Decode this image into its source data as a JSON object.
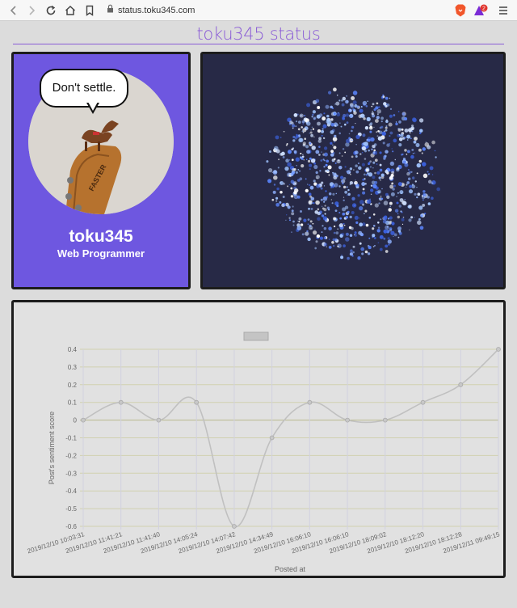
{
  "browser": {
    "url": "status.toku345.com",
    "back_icon": "back-arrow-icon",
    "forward_icon": "forward-arrow-icon",
    "reload_icon": "reload-icon",
    "home_icon": "home-icon",
    "bookmark_icon": "bookmark-icon",
    "lock_icon": "lock-icon",
    "brave_icon": "brave-shield-icon",
    "rewards_badge": "2",
    "menu_icon": "hamburger-menu-icon"
  },
  "page": {
    "title": "toku345 status",
    "accent_color": "#8a5cd6"
  },
  "profile": {
    "speech": "Don't settle.",
    "name": "toku345",
    "role": "Web Programmer",
    "headstock_text": "FASTER",
    "card_color": "#6e57e0"
  },
  "visual": {
    "description_icon": "particle-sphere",
    "background": "#272946"
  },
  "chart_data": {
    "type": "line",
    "categories": [
      "2019/12/10 10:03:31",
      "2019/12/10 11:41:21",
      "2019/12/10 11:41:40",
      "2019/12/10 14:05:24",
      "2019/12/10 14:07:42",
      "2019/12/10 14:34:49",
      "2019/12/10 16:06:10",
      "2019/12/10 16:06:10",
      "2019/12/10 18:09:02",
      "2019/12/10 18:12:20",
      "2019/12/10 18:12:28",
      "2019/12/11 09:49:15"
    ],
    "values": [
      0,
      0.1,
      0,
      0.1,
      -0.6,
      -0.1,
      0.1,
      0,
      0,
      0.1,
      0.2,
      0.4
    ],
    "xlabel": "Posted at",
    "ylabel": "Post's sentiment score",
    "ylim": [
      -0.6,
      0.4
    ],
    "yticks": [
      0.4,
      0.3,
      0.2,
      0.1,
      0,
      -0.1,
      -0.2,
      -0.3,
      -0.4,
      -0.5,
      -0.6
    ],
    "grid": true,
    "legend": "top"
  }
}
